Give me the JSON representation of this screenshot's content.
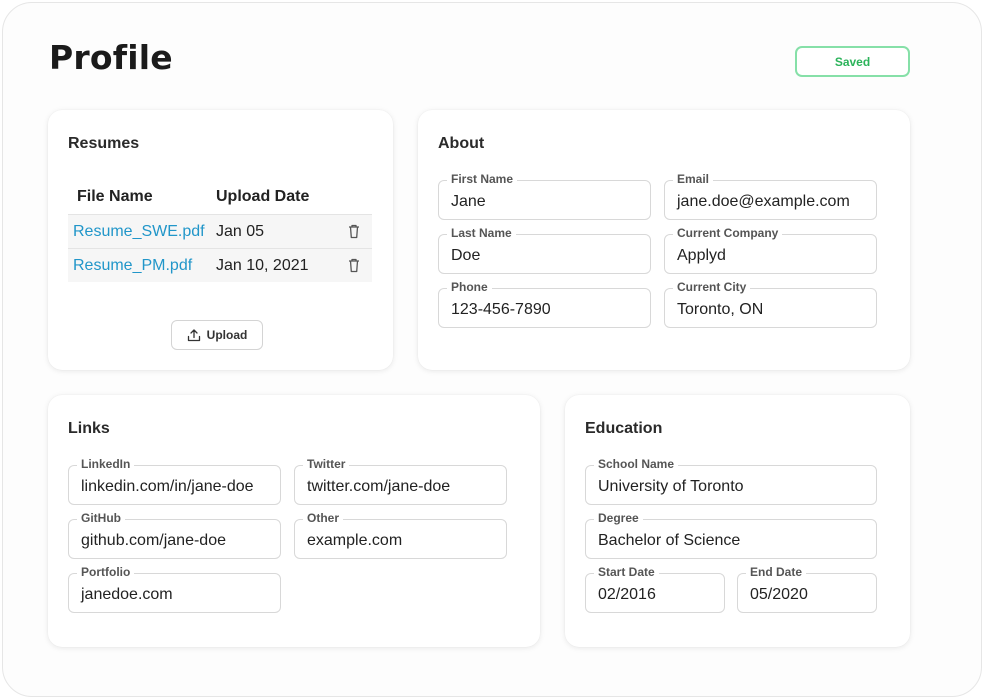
{
  "page": {
    "title": "Profile",
    "status": "Saved"
  },
  "colors": {
    "accent_link": "#2196c9",
    "saved_green": "#2bb35a",
    "saved_border": "#86e0a8"
  },
  "resumes": {
    "title": "Resumes",
    "columns": [
      "File Name",
      "Upload Date"
    ],
    "rows": [
      {
        "file": "Resume_SWE.pdf",
        "date": "Jan 05"
      },
      {
        "file": "Resume_PM.pdf",
        "date": "Jan 10, 2021"
      }
    ],
    "upload_label": "Upload",
    "row_icon": "trash-icon"
  },
  "about": {
    "title": "About",
    "first_name": {
      "label": "First Name",
      "value": "Jane"
    },
    "email": {
      "label": "Email",
      "value": "jane.doe@example.com"
    },
    "last_name": {
      "label": "Last Name",
      "value": "Doe"
    },
    "company": {
      "label": "Current Company",
      "value": "Applyd"
    },
    "phone": {
      "label": "Phone",
      "value": "123-456-7890"
    },
    "city": {
      "label": "Current City",
      "value": "Toronto, ON"
    }
  },
  "links": {
    "title": "Links",
    "linkedin": {
      "label": "LinkedIn",
      "value": "linkedin.com/in/jane-doe"
    },
    "twitter": {
      "label": "Twitter",
      "value": "twitter.com/jane-doe"
    },
    "github": {
      "label": "GitHub",
      "value": "github.com/jane-doe"
    },
    "other": {
      "label": "Other",
      "value": "example.com"
    },
    "portfolio": {
      "label": "Portfolio",
      "value": "janedoe.com"
    }
  },
  "education": {
    "title": "Education",
    "school": {
      "label": "School Name",
      "value": "University of Toronto"
    },
    "degree": {
      "label": "Degree",
      "value": "Bachelor of Science"
    },
    "start": {
      "label": "Start Date",
      "value": "02/2016"
    },
    "end": {
      "label": "End Date",
      "value": "05/2020"
    }
  }
}
